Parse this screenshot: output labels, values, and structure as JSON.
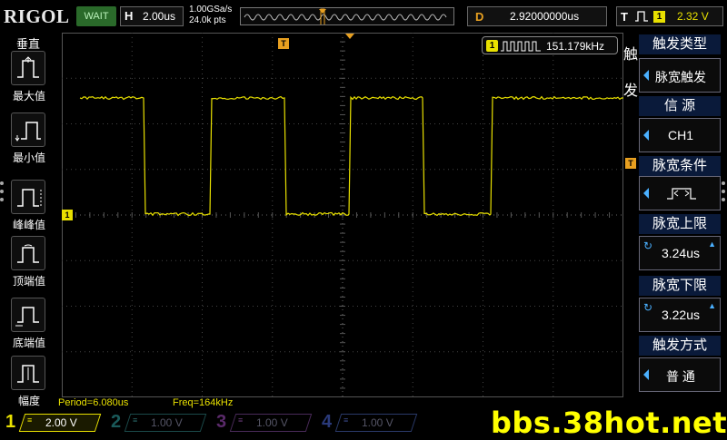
{
  "topbar": {
    "logo_main": "RIGOL",
    "status": "WAIT",
    "horizontal": {
      "label": "H",
      "timebase": "2.00us"
    },
    "sample_rate": "1.00GSa/s",
    "memory_depth": "24.0k pts",
    "delay": {
      "label": "D",
      "value": "2.92000000us"
    },
    "trigger": {
      "label": "T",
      "channel": "1",
      "level": "2.32 V"
    }
  },
  "measure_panel": {
    "title": "垂直",
    "items": [
      {
        "label": "最大值",
        "icon": "vmax-icon"
      },
      {
        "label": "最小值",
        "icon": "vmin-icon"
      },
      {
        "label": "峰峰值",
        "icon": "vpp-icon"
      },
      {
        "label": "顶端值",
        "icon": "vtop-icon"
      },
      {
        "label": "底端值",
        "icon": "vbase-icon"
      },
      {
        "label": "幅度",
        "icon": "vamp-icon"
      }
    ]
  },
  "waveform": {
    "channel_marker": "1",
    "trigger_marker": "T",
    "freq_counter": {
      "channel": "1",
      "value": "151.179kHz"
    },
    "measurements": [
      {
        "label": "Period=6.080us"
      },
      {
        "label": "Freq=164kHz"
      }
    ],
    "color": "#e8e000"
  },
  "trigger_menu": {
    "side_label": "触发",
    "sections": [
      {
        "title": "触发类型",
        "value": "脉宽触发"
      },
      {
        "title": "信 源",
        "value": "CH1"
      },
      {
        "title": "脉宽条件",
        "value": ""
      },
      {
        "title": "脉宽上限",
        "value": "3.24us"
      },
      {
        "title": "脉宽下限",
        "value": "3.22us"
      },
      {
        "title": "触发方式",
        "value": "普 通"
      }
    ]
  },
  "channels": [
    {
      "num": "1",
      "scale": "2.00 V",
      "color": "#e8e000"
    },
    {
      "num": "2",
      "scale": "1.00 V",
      "color": "#2a9a9a"
    },
    {
      "num": "3",
      "scale": "1.00 V",
      "color": "#b040c0"
    },
    {
      "num": "4",
      "scale": "1.00 V",
      "color": "#3060e0"
    }
  ],
  "watermark": "bbs.38hot.net"
}
